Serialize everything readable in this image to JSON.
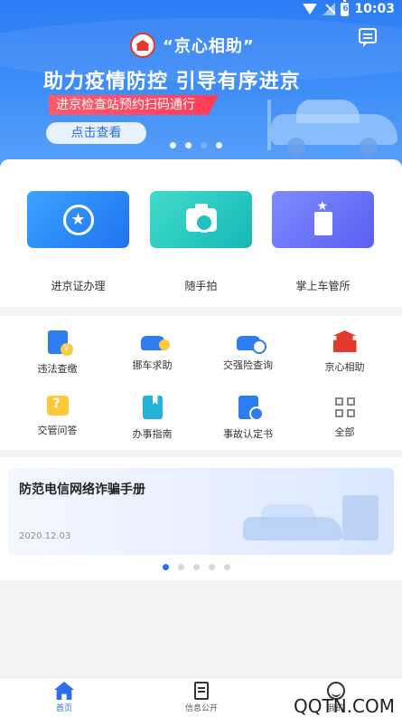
{
  "status_bar": {
    "time": "10:03",
    "battery_label": "6"
  },
  "banner": {
    "brand_name": "“京心相助”",
    "headline": "助力疫情防控 引导有序进京",
    "ribbon_text": "进京检查站预约扫码通行",
    "button_label": "点击查看",
    "dot_count": 4,
    "active_dot_index": 2
  },
  "quick_services": [
    {
      "label": "进京证办理",
      "icon": "star-badge-icon"
    },
    {
      "label": "随手拍",
      "icon": "camera-icon"
    },
    {
      "label": "掌上车管所",
      "icon": "building-icon"
    }
  ],
  "services_grid": {
    "row1": [
      {
        "label": "违法查缴",
        "icon": "ticket-payment-icon"
      },
      {
        "label": "挪车求助",
        "icon": "car-call-icon"
      },
      {
        "label": "交强险查询",
        "icon": "car-insurance-icon"
      },
      {
        "label": "京心相助",
        "icon": "temple-icon"
      }
    ],
    "row2": [
      {
        "label": "交管问答",
        "icon": "qa-icon"
      },
      {
        "label": "办事指南",
        "icon": "guide-book-icon"
      },
      {
        "label": "事故认定书",
        "icon": "accident-cert-icon"
      },
      {
        "label": "全部",
        "icon": "grid-all-icon"
      }
    ]
  },
  "news": {
    "title": "防范电信网络诈骗手册",
    "date": "2020.12.03",
    "dot_count": 5,
    "active_dot_index": 0
  },
  "tabbar": {
    "home": "首页",
    "info": "信息公开",
    "me": "我的"
  },
  "watermark": "QQTN.COM",
  "colors": {
    "accent": "#2c6ee8",
    "brand_red": "#e23b2e"
  }
}
